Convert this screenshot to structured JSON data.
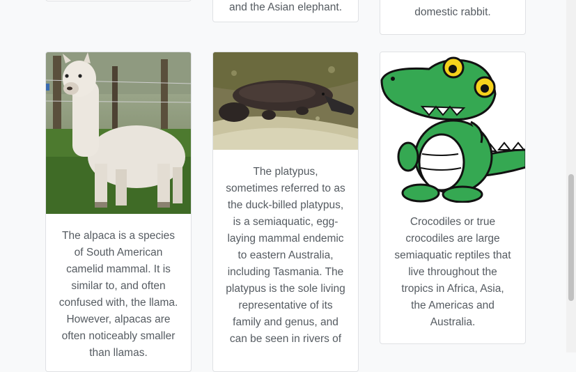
{
  "top_row": {
    "card1": {
      "text": ""
    },
    "card2": {
      "text": "and the Asian elephant."
    },
    "card3": {
      "text": "domestic rabbit."
    }
  },
  "cards": [
    {
      "image_alt": "Alpaca",
      "text": "The alpaca is a species of South American camelid mammal. It is similar to, and often confused with, the llama. However, alpacas are often noticeably smaller than llamas."
    },
    {
      "image_alt": "Platypus",
      "text": "The platypus, sometimes referred to as the duck-billed platypus, is a semiaquatic, egg-laying mammal endemic to eastern Australia, including Tasmania. The platypus is the sole living representative of its family and genus, and can be seen in rivers of"
    },
    {
      "image_alt": "Crocodile",
      "text": "Crocodiles or true crocodiles are large semiaquatic reptiles that live throughout the tropics in Africa, Asia, the Americas and Australia."
    }
  ]
}
